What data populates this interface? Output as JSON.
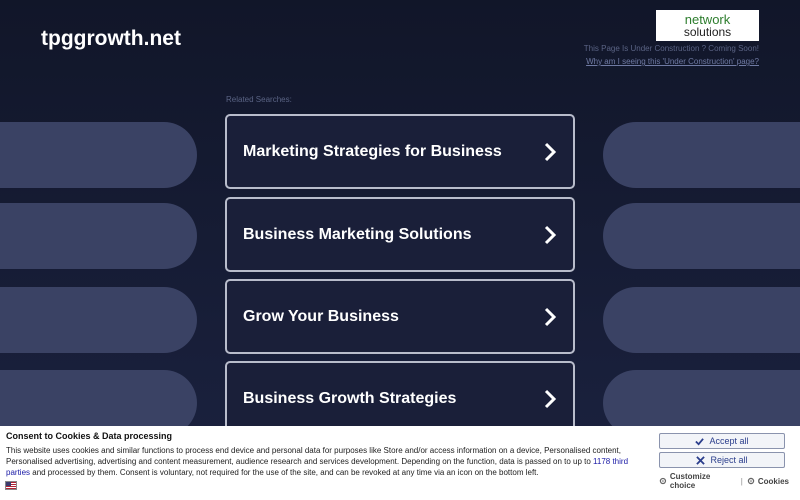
{
  "header": {
    "site_name": "tpggrowth.net",
    "logo_line1": "network",
    "logo_line2": "solutions",
    "under_construction_text": "This Page Is Under Construction ? Coming Soon!",
    "why_link": "Why am I seeing this 'Under Construction' page?"
  },
  "related": {
    "label": "Related Searches:",
    "items": [
      {
        "label": "Marketing Strategies for Business"
      },
      {
        "label": "Business Marketing Solutions"
      },
      {
        "label": "Grow Your Business"
      },
      {
        "label": "Business Growth Strategies"
      }
    ]
  },
  "consent": {
    "title": "Consent to Cookies & Data processing",
    "body_before": "This website uses cookies and similar functions to process end device and personal data for purposes like Store and/or access information on a device, Personalised content, Personalised advertising, advertising and content measurement, audience research and services development. Depending on the function, data is passed on to up to ",
    "third_parties_link": "1178 third parties",
    "body_after": " and processed by them. Consent is voluntary, not required for the use of the site, and can be revoked at any time via an icon on the bottom left.",
    "accept_label": "Accept all",
    "reject_label": "Reject all",
    "customize_label": "Customize choice",
    "separator": "|",
    "cookies_label": "Cookies"
  },
  "colors": {
    "background": "#161b33",
    "pill": "#3a4264",
    "card_border": "#b8bccb",
    "button_text": "#2b3e8c"
  },
  "icons": {
    "card_arrow": "chevron-right-icon",
    "accept": "check-icon",
    "reject": "x-icon",
    "customize": "gear-icon",
    "cookies": "gear-icon",
    "language": "us-flag-icon"
  }
}
